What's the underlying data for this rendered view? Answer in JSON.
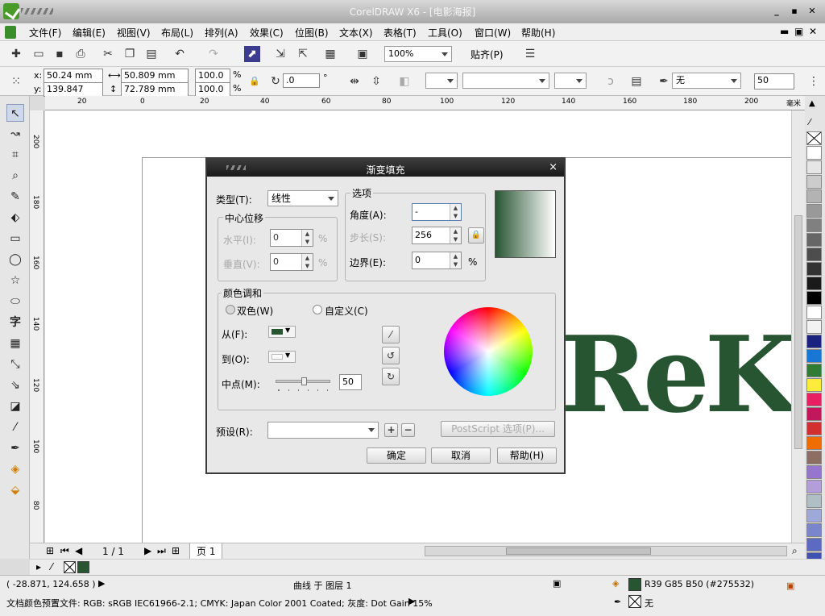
{
  "window": {
    "title": "CorelDRAW X6 - [电影海报]"
  },
  "menu": [
    {
      "label": "文件(F)"
    },
    {
      "label": "编辑(E)"
    },
    {
      "label": "视图(V)"
    },
    {
      "label": "布局(L)"
    },
    {
      "label": "排列(A)"
    },
    {
      "label": "效果(C)"
    },
    {
      "label": "位图(B)"
    },
    {
      "label": "文本(X)"
    },
    {
      "label": "表格(T)"
    },
    {
      "label": "工具(O)"
    },
    {
      "label": "窗口(W)"
    },
    {
      "label": "帮助(H)"
    }
  ],
  "toolbar": {
    "zoom": "100%",
    "snap_label": "贴齐(P)"
  },
  "property_bar": {
    "x_label": "x:",
    "x": "50.24 mm",
    "y_label": "y:",
    "y": "139.847 mm",
    "w": "50.809 mm",
    "h": "72.789 mm",
    "scale_w": "100.0",
    "scale_h": "100.0",
    "pct": "%",
    "rotation": ".0",
    "deg": "°",
    "outline": "无",
    "outline_width": "50"
  },
  "rulers": {
    "h": [
      "20",
      "0",
      "20",
      "40",
      "60",
      "80",
      "100",
      "120",
      "140",
      "160",
      "180",
      "200",
      "毫米"
    ],
    "v": [
      "200",
      "180",
      "160",
      "140",
      "120",
      "100",
      "80"
    ]
  },
  "canvas": {
    "logo_text": "ReK",
    "logo_color": "#275532"
  },
  "palette": [
    "#ffffff",
    "#e6e6e6",
    "#cccccc",
    "#b3b3b3",
    "#999999",
    "#808080",
    "#666666",
    "#4d4d4d",
    "#333333",
    "#1a1a1a",
    "#000000",
    "#ffffff",
    "#f2f2f2",
    "#1a237e",
    "#1976d2",
    "#2e7d32",
    "#ffeb3b",
    "#e91e63",
    "#c2185b",
    "#d32f2f",
    "#ef6c00",
    "#8d6e63",
    "#9575cd",
    "#b39ddb",
    "#b0bec5",
    "#9fa8da",
    "#7986cb",
    "#5c6bc0",
    "#3f51b5",
    "#283593"
  ],
  "dialog": {
    "title": "渐变填充",
    "type_label": "类型(T):",
    "type_value": "线性",
    "center_offset_label": "中心位移",
    "horizontal_label": "水平(I):",
    "horizontal_value": "0",
    "vertical_label": "垂直(V):",
    "vertical_value": "0",
    "pct": "%",
    "options_label": "选项",
    "angle_label": "角度(A):",
    "angle_value": "-",
    "steps_label": "步长(S):",
    "steps_value": "256",
    "edge_label": "边界(E):",
    "edge_value": "0",
    "blend_label": "颜色调和",
    "two_color_label": "双色(W)",
    "custom_label": "自定义(C)",
    "from_label": "从(F):",
    "to_label": "到(O):",
    "from_color": "#275532",
    "to_color": "#ffffff",
    "midpoint_label": "中点(M):",
    "midpoint_value": "50",
    "midpoint_fraction": 0.5,
    "presets_label": "预设(R):",
    "presets_value": "",
    "postscript_label": "PostScript 选项(P)...",
    "ok_label": "确定",
    "cancel_label": "取消",
    "help_label": "帮助(H)"
  },
  "bottom": {
    "page_count": "1 / 1",
    "page_tab": "页 1"
  },
  "status": {
    "coords": "( -28.871, 124.658 )",
    "object": "曲线 于 图层 1",
    "fill": "R39 G85 B50 (#275532)",
    "outline": "无",
    "profile": "文档颜色预置文件: RGB: sRGB IEC61966-2.1; CMYK: Japan Color 2001 Coated; 灰度: Dot Gain 15%"
  }
}
